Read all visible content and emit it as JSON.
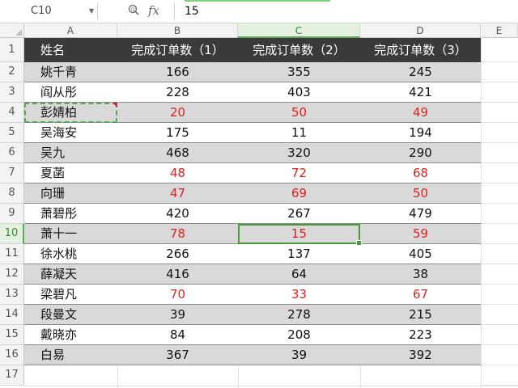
{
  "formula_bar": {
    "cell_ref": "C10",
    "formula_value": "15",
    "fx_label": "fx"
  },
  "columns": [
    "A",
    "B",
    "C",
    "D",
    "E"
  ],
  "selected_column": "C",
  "selected_row": "10",
  "table": {
    "headers": [
      "姓名",
      "完成订单数（1）",
      "完成订单数（2）",
      "完成订单数（3）"
    ],
    "rows": [
      {
        "row": "2",
        "name": "姚千青",
        "v": [
          "166",
          "355",
          "245"
        ],
        "red": [
          false,
          false,
          false
        ],
        "bg": "gray"
      },
      {
        "row": "3",
        "name": "阎从彤",
        "v": [
          "228",
          "403",
          "421"
        ],
        "red": [
          false,
          false,
          false
        ],
        "bg": "white"
      },
      {
        "row": "4",
        "name": "彭婧柏",
        "v": [
          "20",
          "50",
          "49"
        ],
        "red": [
          true,
          true,
          true
        ],
        "bg": "gray"
      },
      {
        "row": "5",
        "name": "吴海安",
        "v": [
          "175",
          "11",
          "194"
        ],
        "red": [
          false,
          false,
          false
        ],
        "bg": "white"
      },
      {
        "row": "6",
        "name": "吴九",
        "v": [
          "468",
          "320",
          "290"
        ],
        "red": [
          false,
          false,
          false
        ],
        "bg": "gray"
      },
      {
        "row": "7",
        "name": "夏菡",
        "v": [
          "48",
          "72",
          "68"
        ],
        "red": [
          true,
          true,
          true
        ],
        "bg": "white"
      },
      {
        "row": "8",
        "name": "向珊",
        "v": [
          "47",
          "69",
          "50"
        ],
        "red": [
          true,
          true,
          true
        ],
        "bg": "gray"
      },
      {
        "row": "9",
        "name": "萧碧彤",
        "v": [
          "420",
          "267",
          "479"
        ],
        "red": [
          false,
          false,
          false
        ],
        "bg": "white"
      },
      {
        "row": "10",
        "name": "萧十一",
        "v": [
          "78",
          "15",
          "59"
        ],
        "red": [
          true,
          true,
          true
        ],
        "bg": "gray"
      },
      {
        "row": "11",
        "name": "徐水桃",
        "v": [
          "266",
          "137",
          "405"
        ],
        "red": [
          false,
          false,
          false
        ],
        "bg": "white"
      },
      {
        "row": "12",
        "name": "薛凝天",
        "v": [
          "416",
          "64",
          "38"
        ],
        "red": [
          false,
          false,
          false
        ],
        "bg": "gray"
      },
      {
        "row": "13",
        "name": "梁碧凡",
        "v": [
          "70",
          "33",
          "67"
        ],
        "red": [
          true,
          true,
          true
        ],
        "bg": "white"
      },
      {
        "row": "14",
        "name": "段曼文",
        "v": [
          "39",
          "278",
          "215"
        ],
        "red": [
          false,
          false,
          false
        ],
        "bg": "gray"
      },
      {
        "row": "15",
        "name": "戴晓亦",
        "v": [
          "84",
          "208",
          "223"
        ],
        "red": [
          false,
          false,
          false
        ],
        "bg": "white"
      },
      {
        "row": "16",
        "name": "白易",
        "v": [
          "367",
          "39",
          "392"
        ],
        "red": [
          false,
          false,
          false
        ],
        "bg": "gray"
      }
    ]
  },
  "row_labels": [
    "1",
    "2",
    "3",
    "4",
    "5",
    "6",
    "7",
    "8",
    "9",
    "10",
    "11",
    "12",
    "13",
    "14",
    "15",
    "16",
    "17"
  ],
  "colors": {
    "header_bg": "#3a3a3a",
    "stripe_gray": "#d9d9d9",
    "low_value_red": "#e02020",
    "selection_green": "#4a9a3a"
  }
}
